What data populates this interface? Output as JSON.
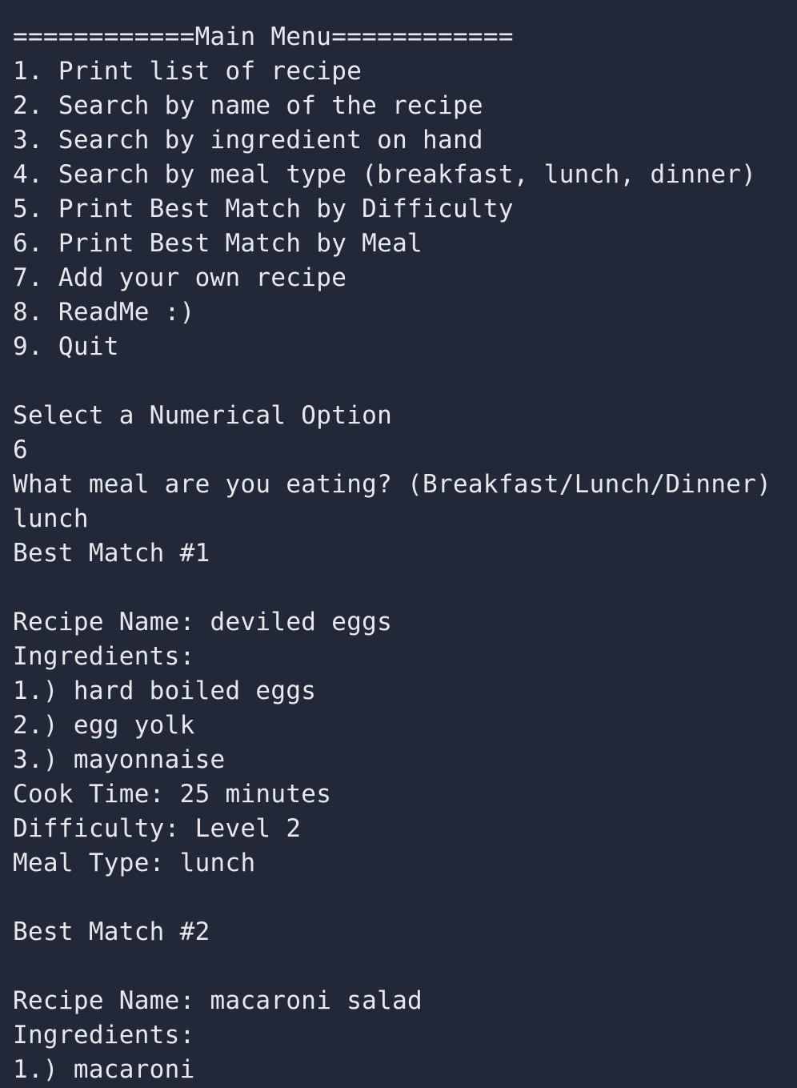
{
  "menu": {
    "header": "============Main Menu============",
    "options": [
      "1. Print list of recipe",
      "2. Search by name of the recipe",
      "3. Search by ingredient on hand",
      "4. Search by meal type (breakfast, lunch, dinner)",
      "5. Print Best Match by Difficulty",
      "6. Print Best Match by Meal",
      "7. Add your own recipe",
      "8. ReadMe :)",
      "9. Quit"
    ]
  },
  "prompt": {
    "select": "Select a Numerical Option",
    "select_input": "6",
    "meal_question": "What meal are you eating? (Breakfast/Lunch/Dinner)",
    "meal_input": "lunch"
  },
  "matches": [
    {
      "heading": "Best Match #1",
      "name_line": "Recipe Name: deviled eggs",
      "ingredients_heading": "Ingredients:",
      "ingredients": [
        "1.) hard boiled eggs",
        "2.) egg yolk",
        "3.) mayonnaise"
      ],
      "cook_time": "Cook Time: 25 minutes",
      "difficulty": "Difficulty: Level 2",
      "meal_type": "Meal Type: lunch"
    },
    {
      "heading": "Best Match #2",
      "name_line": "Recipe Name: macaroni salad",
      "ingredients_heading": "Ingredients:",
      "ingredients": [
        "1.) macaroni"
      ]
    }
  ]
}
